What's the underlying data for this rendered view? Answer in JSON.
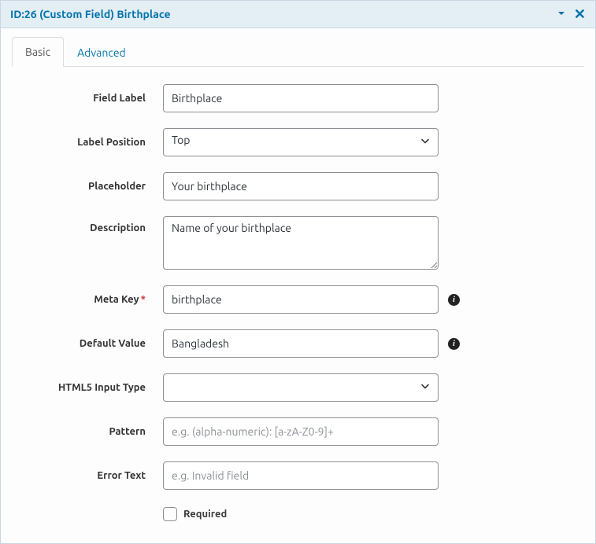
{
  "header": {
    "title": "ID:26 (Custom Field) Birthplace"
  },
  "tabs": {
    "basic": "Basic",
    "advanced": "Advanced"
  },
  "labels": {
    "field_label": "Field Label",
    "label_position": "Label Position",
    "placeholder": "Placeholder",
    "description": "Description",
    "meta_key": "Meta Key",
    "default_value": "Default Value",
    "html5_input_type": "HTML5 Input Type",
    "pattern": "Pattern",
    "error_text": "Error Text",
    "required": "Required"
  },
  "values": {
    "field_label": "Birthplace",
    "label_position": "Top",
    "placeholder": "Your birthplace",
    "description": "Name of your birthplace",
    "meta_key": "birthplace",
    "default_value": "Bangladesh",
    "html5_input_type": "",
    "pattern": "",
    "error_text": ""
  },
  "placeholders": {
    "pattern": "e.g. (alpha-numeric): [a-zA-Z0-9]+",
    "error_text": "e.g. Invalid field"
  }
}
